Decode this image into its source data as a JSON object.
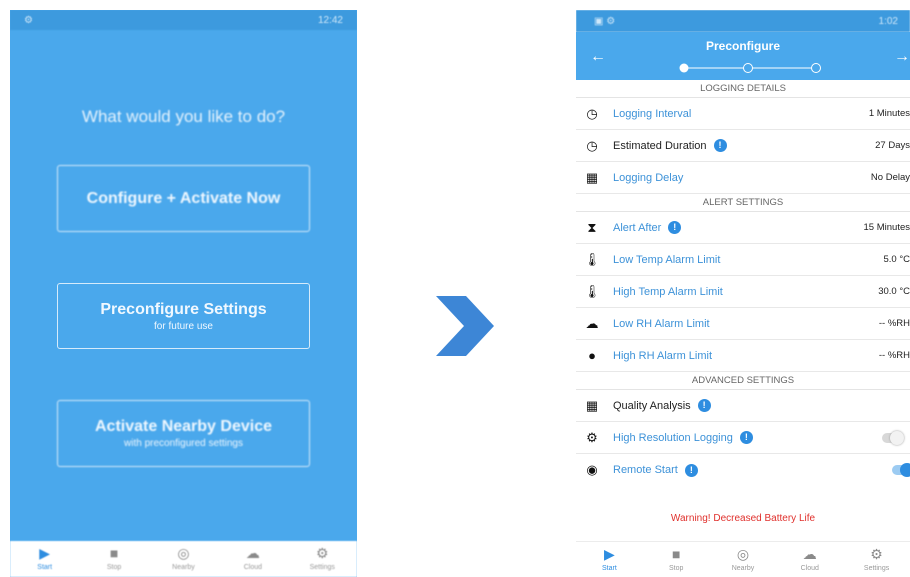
{
  "left": {
    "status_time": "12:42",
    "question": "What would you like to do?",
    "buttons": {
      "configure": {
        "label": "Configure + Activate Now"
      },
      "preconfigure": {
        "label": "Preconfigure Settings",
        "sub": "for future use"
      },
      "nearby": {
        "label": "Activate Nearby Device",
        "sub": "with preconfigured settings"
      }
    }
  },
  "nav": {
    "items": [
      {
        "label": "Start",
        "icon": "play-icon"
      },
      {
        "label": "Stop",
        "icon": "stop-icon"
      },
      {
        "label": "Nearby",
        "icon": "nearby-icon"
      },
      {
        "label": "Cloud",
        "icon": "cloud-icon"
      },
      {
        "label": "Settings",
        "icon": "gear-icon"
      }
    ]
  },
  "right": {
    "status_time": "1:02",
    "title": "Preconfigure",
    "sections": {
      "logging": "LOGGING DETAILS",
      "alert": "ALERT SETTINGS",
      "advanced": "ADVANCED SETTINGS"
    },
    "rows": {
      "logging_interval": {
        "label": "Logging Interval",
        "value": "1 Minutes",
        "icon": "clock-icon"
      },
      "estimated_duration": {
        "label": "Estimated Duration",
        "value": "27 Days",
        "icon": "clock-icon"
      },
      "logging_delay": {
        "label": "Logging Delay",
        "value": "No Delay",
        "icon": "calendar-icon"
      },
      "alert_after": {
        "label": "Alert After",
        "value": "15 Minutes",
        "icon": "hourglass-icon"
      },
      "low_temp": {
        "label": "Low Temp Alarm Limit",
        "value": "5.0 °C",
        "icon": "thermometer-low-icon"
      },
      "high_temp": {
        "label": "High Temp Alarm Limit",
        "value": "30.0 °C",
        "icon": "thermometer-high-icon"
      },
      "low_rh": {
        "label": "Low RH Alarm Limit",
        "value": "-- %RH",
        "icon": "cloud-icon"
      },
      "high_rh": {
        "label": "High RH Alarm Limit",
        "value": "-- %RH",
        "icon": "drop-icon"
      },
      "quality": {
        "label": "Quality Analysis",
        "icon": "calculator-icon"
      },
      "high_res": {
        "label": "High Resolution Logging",
        "icon": "gears-icon",
        "enabled": false
      },
      "remote_start": {
        "label": "Remote Start",
        "icon": "signal-icon",
        "enabled": true
      }
    },
    "warning": "Warning! Decreased Battery Life"
  },
  "colors": {
    "primary": "#4aa8ec",
    "accent": "#2e8de0",
    "warning": "#e0302c"
  }
}
